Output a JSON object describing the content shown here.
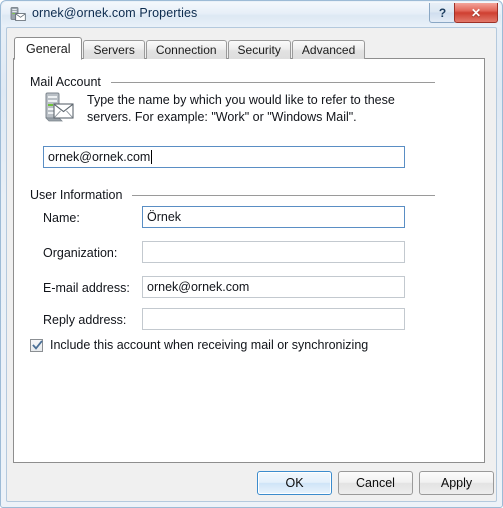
{
  "window": {
    "title": "ornek@ornek.com Properties",
    "icon": "mail-server-icon",
    "help_label": "?",
    "close_label": "✕"
  },
  "tabs": [
    {
      "label": "General",
      "active": true
    },
    {
      "label": "Servers",
      "active": false
    },
    {
      "label": "Connection",
      "active": false
    },
    {
      "label": "Security",
      "active": false
    },
    {
      "label": "Advanced",
      "active": false
    }
  ],
  "mail_account": {
    "group_label": "Mail Account",
    "icon": "mail-server-icon",
    "description": "Type the name by which you would like to refer to these servers.  For example: \"Work\" or \"Windows Mail\".",
    "account_name_value": "ornek@ornek.com",
    "account_name_placeholder": ""
  },
  "user_information": {
    "group_label": "User Information",
    "fields": [
      {
        "label": "Name:",
        "value": "Örnek",
        "placeholder": ""
      },
      {
        "label": "Organization:",
        "value": "",
        "placeholder": ""
      },
      {
        "label": "E-mail address:",
        "value": "ornek@ornek.com",
        "placeholder": ""
      },
      {
        "label": "Reply address:",
        "value": "",
        "placeholder": ""
      }
    ]
  },
  "include_account": {
    "label": "Include this account when receiving mail or synchronizing",
    "checked": true
  },
  "buttons": {
    "ok": "OK",
    "cancel": "Cancel",
    "apply": "Apply"
  },
  "colors": {
    "titlebar_text": "#0c2b4e",
    "close_red": "#cf3f31",
    "default_button_border": "#3c8ccd",
    "field_border": "#abadb3"
  }
}
